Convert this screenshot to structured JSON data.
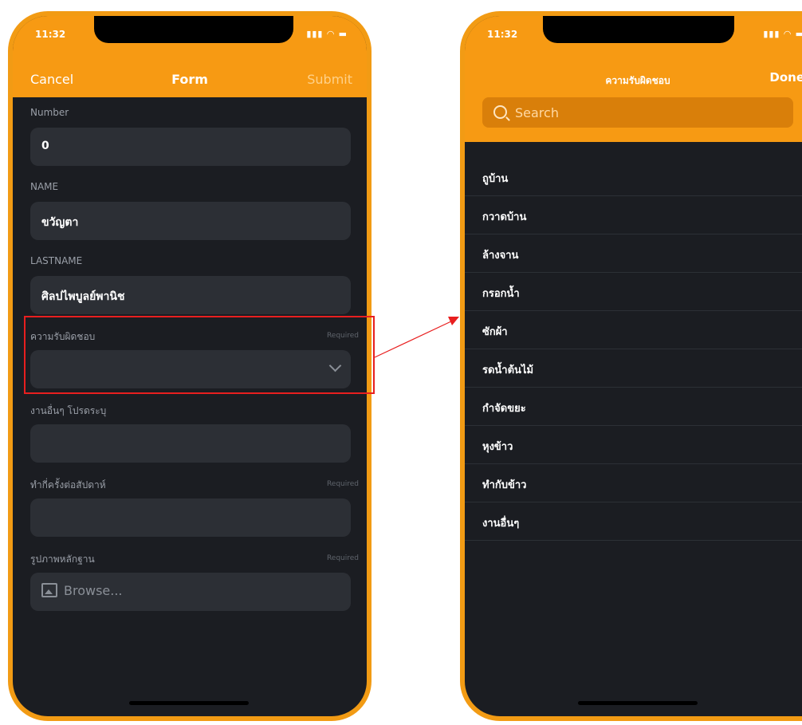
{
  "form_screen": {
    "status_time": "11:32",
    "nav": {
      "cancel": "Cancel",
      "title": "Form",
      "submit": "Submit"
    },
    "fields": [
      {
        "label": "Number",
        "value": "0",
        "required": ""
      },
      {
        "label": "NAME",
        "value": "ขวัญตา",
        "required": ""
      },
      {
        "label": "LASTNAME",
        "value": "ศิลปไพบูลย์พานิช",
        "required": ""
      },
      {
        "label": "ความรับผิดชอบ",
        "value": "",
        "required": "Required"
      },
      {
        "label": "งานอื่นๆ โปรดระบุ",
        "value": "",
        "required": ""
      },
      {
        "label": "ทำกี่ครั้งต่อสัปดาห์",
        "value": "",
        "required": "Required"
      },
      {
        "label": "รูปภาพหลักฐาน",
        "value": "Browse...",
        "required": "Required"
      }
    ]
  },
  "picker_screen": {
    "status_time": "11:32",
    "nav": {
      "title": "ความรับผิดชอบ",
      "done": "Done"
    },
    "search": {
      "placeholder": "Search"
    },
    "options": [
      "ถูบ้าน",
      "กวาดบ้าน",
      "ล้างจาน",
      "กรอกน้ำ",
      "ซักผ้า",
      "รดน้ำต้นไม้",
      "กำจัดขยะ",
      "หุงข้าว",
      "ทำกับข้าว",
      "งานอื่นๆ"
    ]
  },
  "colors": {
    "accent": "#f79a13",
    "background": "#1b1d22",
    "field": "#2c2f35",
    "highlight": "#e81f1f"
  }
}
